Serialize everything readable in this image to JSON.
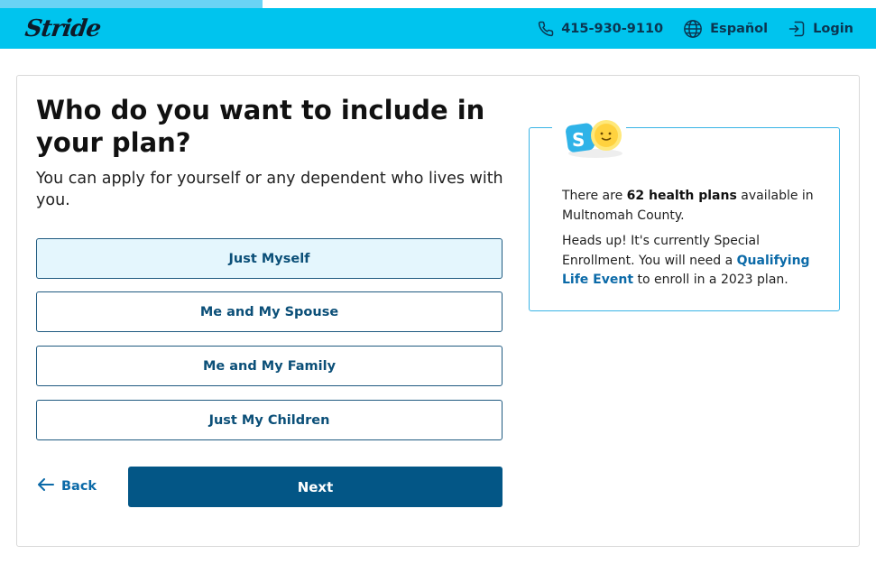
{
  "progress": {
    "fraction": 0.3
  },
  "header": {
    "logo": "Stride",
    "phone": "415-930-9110",
    "language": "Español",
    "login": "Login"
  },
  "main": {
    "title": "Who do you want to include in your plan?",
    "subtitle": "You can apply for yourself or any dependent who lives with you.",
    "options": [
      {
        "label": "Just Myself",
        "selected": true
      },
      {
        "label": "Me and My Spouse",
        "selected": false
      },
      {
        "label": "Me and My Family",
        "selected": false
      },
      {
        "label": "Just My Children",
        "selected": false
      }
    ],
    "back_label": "Back",
    "next_label": "Next"
  },
  "info": {
    "avatar_letter": "S",
    "p1_pre": "There are ",
    "p1_bold": "62 health plans",
    "p1_post": " available in Multnomah County.",
    "p2_pre": "Heads up! It's currently Special Enrollment. You will need a ",
    "p2_link": "Qualifying Life Event",
    "p2_post": " to enroll in a 2023 plan."
  },
  "colors": {
    "header_bg": "#00c4ee",
    "primary": "#035686",
    "link": "#0b6aa8",
    "selected_bg": "#e4f6fd"
  }
}
